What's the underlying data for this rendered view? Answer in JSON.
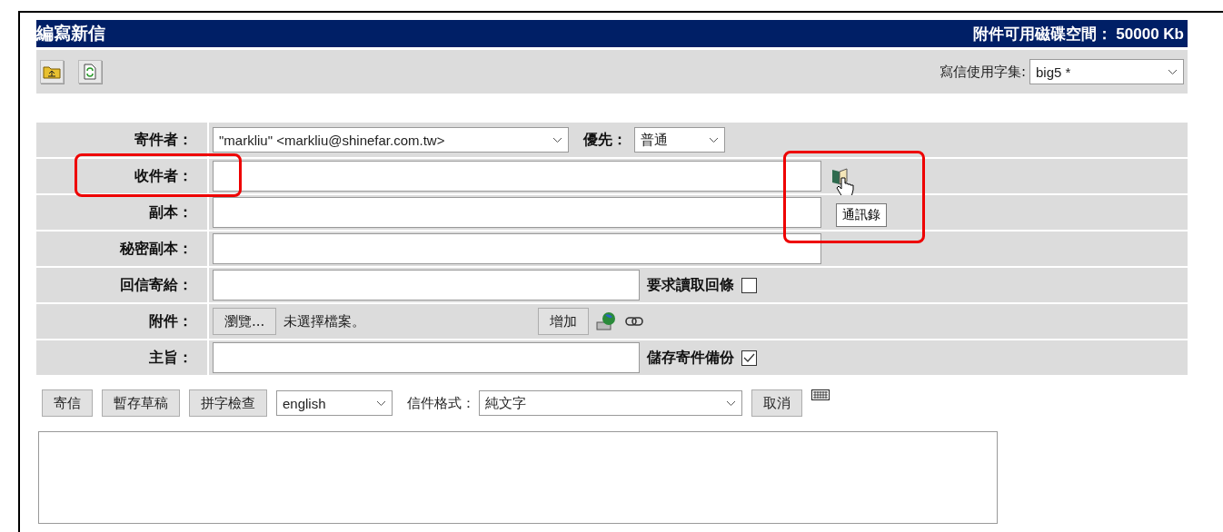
{
  "title": "編寫新信",
  "quota": "附件可用磁碟空間： 50000 Kb",
  "toolbar": {
    "charset_label": "寫信使用字集:",
    "charset": "big5 *"
  },
  "rows": [
    {
      "kind": "select",
      "label": "寄件者：",
      "value": "\"markliu\" <markliu@shinefar.com.tw>",
      "priority_label": "優先：",
      "priority": "普通"
    },
    {
      "kind": "input",
      "label": "收件者：",
      "highlighted": true,
      "address_book": {
        "tooltip": "通訊錄",
        "highlighted": true
      }
    },
    {
      "kind": "input",
      "label": "副本："
    },
    {
      "kind": "input",
      "label": "秘密副本："
    },
    {
      "kind": "input-check",
      "label": "回信寄給：",
      "check_label": "要求讀取回條",
      "checked": false
    },
    {
      "kind": "file",
      "label": "附件：",
      "browse": "瀏覽...",
      "file": "未選擇檔案。",
      "add": "增加"
    },
    {
      "kind": "input-check",
      "label": "主旨：",
      "check_label": "儲存寄件備份",
      "checked": true
    }
  ],
  "actions": [
    {
      "kind": "button",
      "label": "寄信"
    },
    {
      "kind": "button",
      "label": "暫存草稿"
    },
    {
      "kind": "button",
      "label": "拼字檢查"
    },
    {
      "kind": "select",
      "value": "english"
    },
    {
      "kind": "label",
      "label": "信件格式："
    },
    {
      "kind": "select",
      "value": "純文字",
      "wide": true
    },
    {
      "kind": "button",
      "label": "取消"
    },
    {
      "kind": "keyboard"
    }
  ]
}
